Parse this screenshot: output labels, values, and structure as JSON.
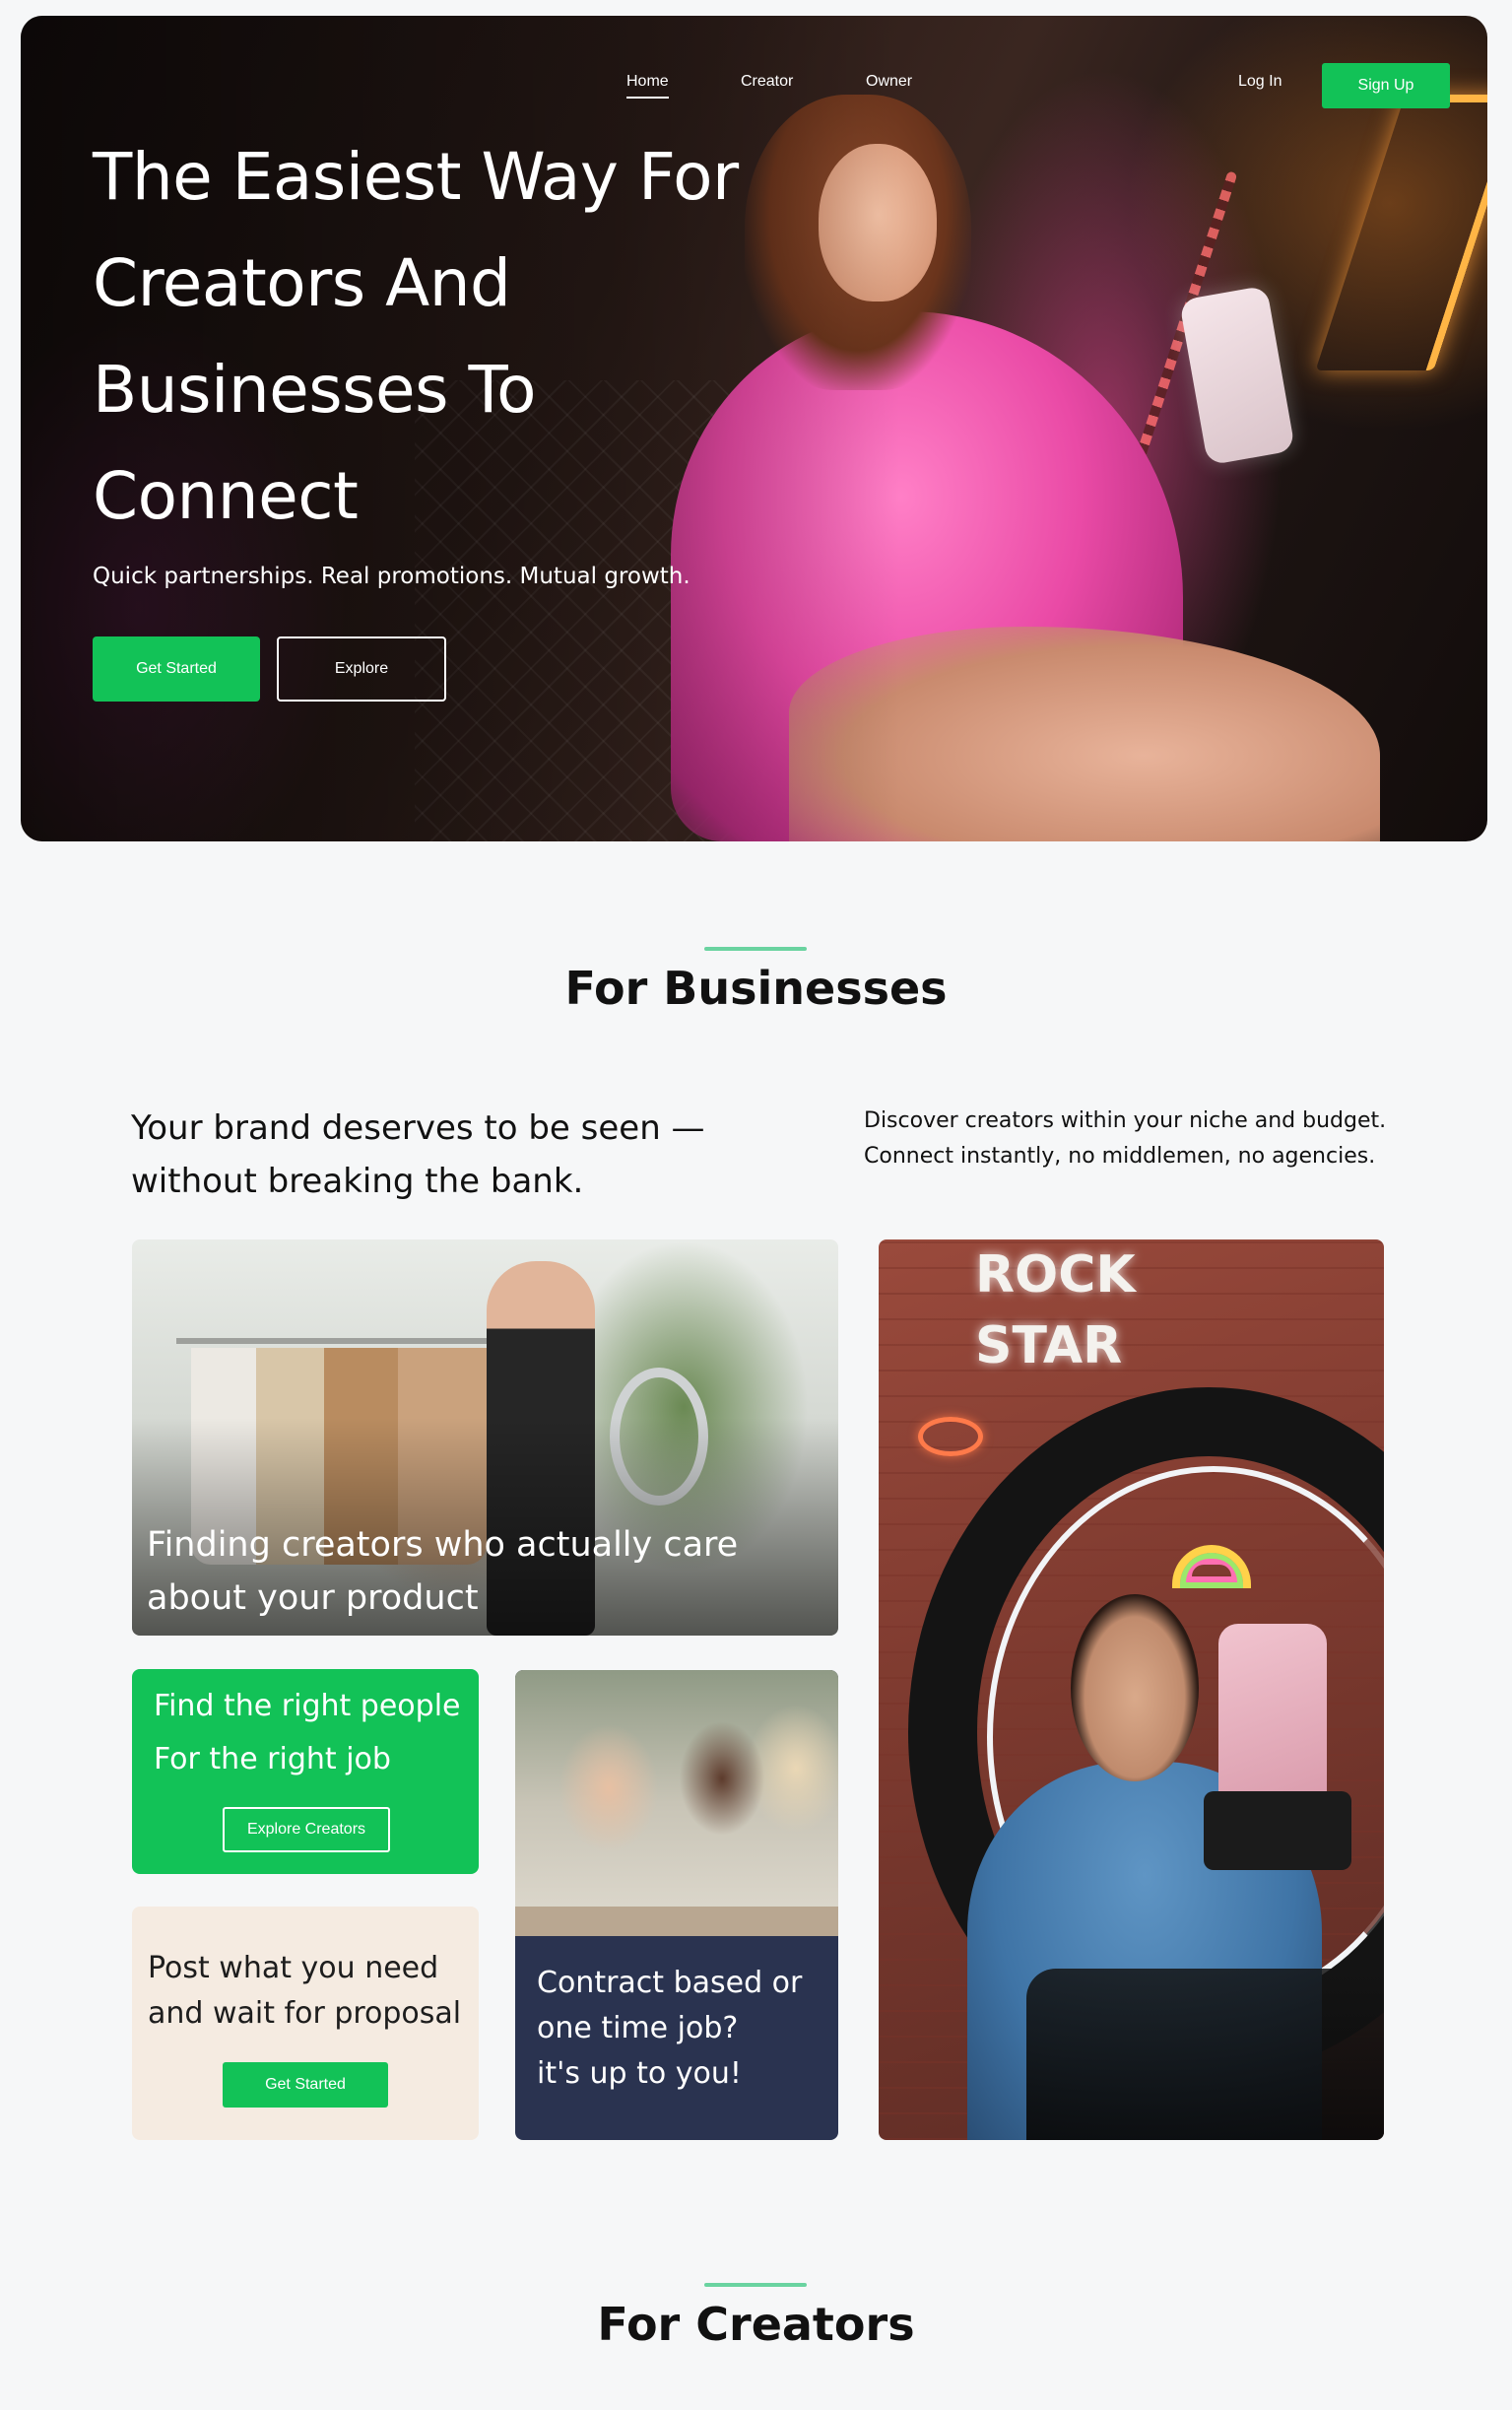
{
  "nav": {
    "links": [
      "Home",
      "Creator",
      "Owner"
    ],
    "login": "Log In",
    "signup": "Sign Up"
  },
  "hero": {
    "title_lines": [
      "The Easiest Way For",
      "Creators And",
      "Businesses To",
      "Connect"
    ],
    "subtitle": "Quick partnerships. Real promotions. Mutual growth.",
    "primary_button": "Get Started",
    "secondary_button": "Explore"
  },
  "businesses": {
    "heading": "For Businesses",
    "lead_lines": [
      "Your brand deserves to be seen —",
      "without breaking the bank."
    ],
    "lead_right_lines": [
      "Discover creators within your niche and budget.",
      "Connect instantly, no middlemen, no agencies."
    ],
    "card_rack": {
      "caption_lines": [
        "Finding creators who actually care",
        "about your product"
      ]
    },
    "card_green": {
      "line1": "Find the right people",
      "line2": "For the right job",
      "button": "Explore Creators"
    },
    "card_beige": {
      "lines": [
        "Post what you need",
        "and wait for proposal"
      ],
      "button": "Get Started"
    },
    "card_navy": {
      "lines": [
        "Contract based or",
        "one time job?",
        "it's up to you!"
      ]
    },
    "card_ring": {
      "neon_lines": [
        "ROCK",
        "STAR"
      ]
    }
  },
  "creators": {
    "heading": "For Creators"
  },
  "colors": {
    "accent_green": "#12c257",
    "navy_card": "#2a3350",
    "beige_card": "#f5ebe1",
    "page_bg": "#f6f7f8"
  }
}
